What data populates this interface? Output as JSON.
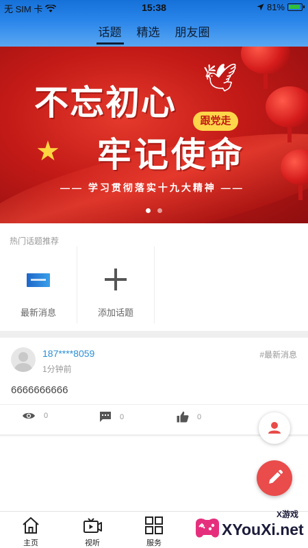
{
  "status_bar": {
    "carrier": "无 SIM 卡",
    "time": "15:38",
    "battery": "81%"
  },
  "tabs": [
    {
      "label": "话题",
      "active": true
    },
    {
      "label": "精选",
      "active": false
    },
    {
      "label": "朋友圈",
      "active": false
    }
  ],
  "banner": {
    "line1": "不忘初心",
    "line2": "牢记使命",
    "badge": "跟党走",
    "subtitle": "—— 学习贯彻落实十九大精神 ——",
    "page_count": 2,
    "active_page": 1
  },
  "hot_topics": {
    "title": "热门话题推荐",
    "items": [
      {
        "label": "最新消息",
        "icon": "news-thumbnail"
      },
      {
        "label": "添加话题",
        "icon": "plus-icon"
      }
    ]
  },
  "post": {
    "user": "187****8059",
    "time": "1分钟前",
    "tag": "#最新消息",
    "content": "6666666666",
    "views": "0",
    "comments": "0",
    "likes": "0"
  },
  "bottom_nav": [
    {
      "label": "主页",
      "icon": "home-icon"
    },
    {
      "label": "视听",
      "icon": "video-icon"
    },
    {
      "label": "服务",
      "icon": "grid-icon"
    }
  ],
  "watermark": {
    "text": "XYouXi.net",
    "top": "X游戏"
  },
  "colors": {
    "header": "#2a86ea",
    "link": "#2a8fd6",
    "fab": "#ea4b4b",
    "banner": "#c31a17"
  }
}
